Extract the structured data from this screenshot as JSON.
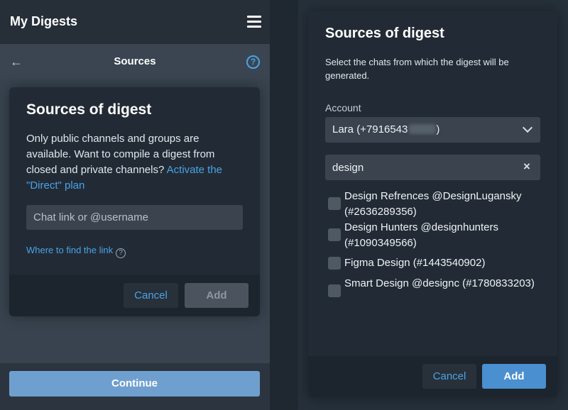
{
  "app": {
    "title": "My Digests"
  },
  "icons": {
    "menu": "hamburger-menu-icon",
    "back": "arrow-left-icon",
    "help": "question-circle-icon",
    "clear": "close-icon",
    "chevron": "chevron-down-icon"
  },
  "colors": {
    "accent": "#4aa3e8",
    "primary_button": "#4a8fd0",
    "continue_button": "#6f9fce"
  },
  "left_pane": {
    "nav": {
      "title": "Sources",
      "help_glyph": "?"
    },
    "dialog": {
      "title": "Sources of digest",
      "description": "Only public channels and groups are available. Want to compile a digest from closed and private channels? ",
      "description_link": "Activate the \"Direct\" plan",
      "input_placeholder": "Chat link or @username",
      "input_value": "",
      "where_link": "Where to find the link",
      "where_glyph": "?",
      "cancel_label": "Cancel",
      "add_label": "Add"
    },
    "continue_label": "Continue"
  },
  "right_pane": {
    "dialog": {
      "title": "Sources of digest",
      "description": "Select the chats from which the digest will be generated.",
      "account_label": "Account",
      "account_value_prefix": "Lara (+7916543",
      "account_value_suffix": ")",
      "search_value": "design",
      "clear_glyph": "×",
      "chats": [
        {
          "label": "Design Refrences @DesignLugansky (#2636289356)",
          "checked": false
        },
        {
          "label": "Design Hunters @designhunters (#1090349566)",
          "checked": false
        },
        {
          "label": "Figma Design (#1443540902)",
          "checked": false
        },
        {
          "label": "Smart Design @designc (#1780833203)",
          "checked": false
        }
      ],
      "cancel_label": "Cancel",
      "add_label": "Add"
    }
  }
}
